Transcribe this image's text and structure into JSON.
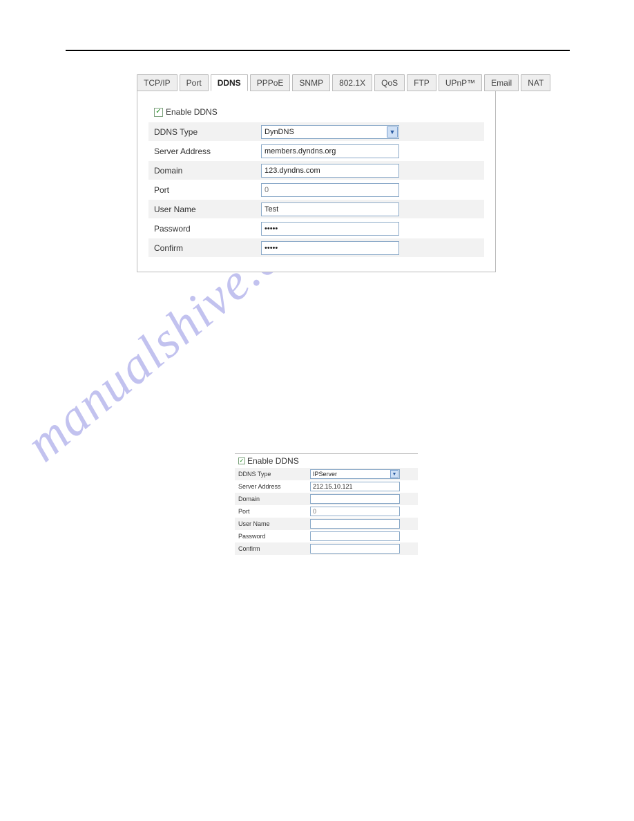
{
  "tabs": [
    "TCP/IP",
    "Port",
    "DDNS",
    "PPPoE",
    "SNMP",
    "802.1X",
    "QoS",
    "FTP",
    "UPnP™",
    "Email",
    "NAT"
  ],
  "active_tab": "DDNS",
  "panel_top": {
    "enable_label": "Enable DDNS",
    "enable_checked": true,
    "rows": {
      "ddns_type": {
        "label": "DDNS Type",
        "value": "DynDNS",
        "type": "select"
      },
      "server_address": {
        "label": "Server Address",
        "value": "members.dyndns.org"
      },
      "domain": {
        "label": "Domain",
        "value": "123.dyndns.com"
      },
      "port": {
        "label": "Port",
        "value": "",
        "placeholder": "0"
      },
      "user_name": {
        "label": "User Name",
        "value": "Test"
      },
      "password": {
        "label": "Password",
        "value": "•••••"
      },
      "confirm": {
        "label": "Confirm",
        "value": "•••••"
      }
    }
  },
  "panel_bottom": {
    "enable_label": "Enable DDNS",
    "enable_checked": true,
    "rows": {
      "ddns_type": {
        "label": "DDNS Type",
        "value": "IPServer",
        "type": "select"
      },
      "server_address": {
        "label": "Server Address",
        "value": "212.15.10.121"
      },
      "domain": {
        "label": "Domain",
        "value": ""
      },
      "port": {
        "label": "Port",
        "value": "",
        "placeholder": "0"
      },
      "user_name": {
        "label": "User Name",
        "value": ""
      },
      "password": {
        "label": "Password",
        "value": ""
      },
      "confirm": {
        "label": "Confirm",
        "value": ""
      }
    }
  },
  "watermark": "manualshive.com"
}
